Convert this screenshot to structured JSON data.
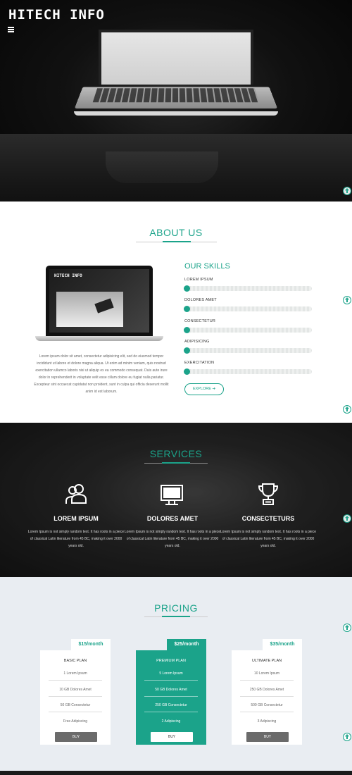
{
  "header": {
    "logo": "HITECH INFO",
    "menu_icon": "hamburger-icon"
  },
  "about": {
    "title": "ABOUT US",
    "device_logo": "HITECH INFO",
    "paragraph": "Lorem ipsum dolor sit amet, consectetur adipisicing elit, sed do eiusmod tempor incididunt ut labore et dolore magna aliqua. Ut enim ad minim veniam, quis nostrud exercitation ullamco laboris nisi ut aliquip ex ea commodo consequat. Duis aute irure dolor in reprehenderit in voluptate velit esse cillum dolore eu fugiat nulla pariatur. Excepteur sint occaecat cupidatat non proident, sunt in culpa qui officia deserunt mollit anim id est laborum.",
    "skills_title": "OUR SKILLS",
    "skills": [
      {
        "label": "LOREM IPSUM"
      },
      {
        "label": "DOLORES AMET"
      },
      {
        "label": "CONSECTETUR"
      },
      {
        "label": "ADIPISICING"
      },
      {
        "label": "EXERCITATION"
      }
    ],
    "explore_label": "EXPLORE ➔"
  },
  "services": {
    "title": "SERVICES",
    "items": [
      {
        "icon": "users-icon",
        "name": "LOREM IPSUM",
        "text": "Lorem Ipsum is not simply random text. It has roots in a piece of classical Latin literature from 45 BC, making it over 2000 years old."
      },
      {
        "icon": "monitor-icon",
        "name": "DOLORES AMET",
        "text": "Lorem Ipsum is not simply random text. It has roots in a piece of classical Latin literature from 45 BC, making it over 2000 years old."
      },
      {
        "icon": "trophy-icon",
        "name": "CONSECTETURS",
        "text": "Lorem Ipsum is not simply random text. It has roots in a piece of classical Latin literature from 45 BC, making it over 2000 years old."
      }
    ]
  },
  "pricing": {
    "title": "PRICING",
    "plans": [
      {
        "price": "$15/month",
        "name": "BASIC PLAN",
        "features": [
          "1 Lorem Ipsum",
          "10 GB Dolores Amet",
          "50 GB Consectetur",
          "Free Adipiscing"
        ],
        "buy": "BUY"
      },
      {
        "price": "$25/month",
        "name": "PREMIUM PLAN",
        "features": [
          "5 Lorem Ipsum",
          "50 GB Dolores Amet",
          "250 GB Consectetur",
          "2 Adipiscing"
        ],
        "buy": "BUY"
      },
      {
        "price": "$35/month",
        "name": "ULTIMATE PLAN",
        "features": [
          "10 Lorem Ipsum",
          "250 GB Dolores Amet",
          "500 GB Consectetur",
          "3 Adipiscing"
        ],
        "buy": "BUY"
      }
    ]
  },
  "colors": {
    "accent": "#1ba38a",
    "dark": "#111111",
    "pricing_bg": "#e9edf2"
  }
}
